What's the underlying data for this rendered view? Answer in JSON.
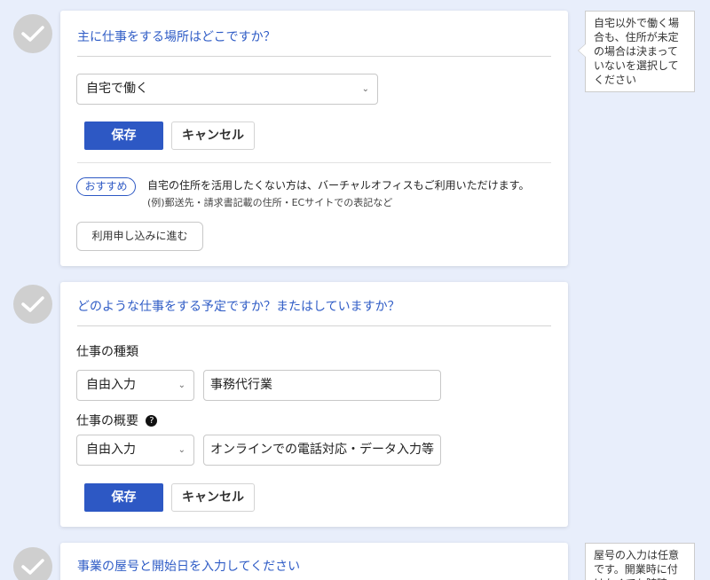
{
  "section1": {
    "title": "主に仕事をする場所はどこですか？",
    "select_value": "自宅で働く",
    "save_label": "保存",
    "cancel_label": "キャンセル",
    "badge": "おすすめ",
    "recommend_text": "自宅の住所を活用したくない方は、バーチャルオフィスもご利用いただけます。",
    "recommend_sub": "(例)郵送先・請求書記載の住所・ECサイトでの表記など",
    "apply_label": "利用申し込みに進む",
    "tooltip": "自宅以外で働く場合も、住所が未定の場合は決まっていないを選択してください"
  },
  "section2": {
    "title": "どのような仕事をする予定ですか？またはしていますか？",
    "type_label": "仕事の種類",
    "type_select": "自由入力",
    "type_value": "事務代行業",
    "summary_label": "仕事の概要",
    "summary_select": "自由入力",
    "summary_value": "オンラインでの電話対応・データ入力等",
    "save_label": "保存",
    "cancel_label": "キャンセル"
  },
  "section3": {
    "title": "事業の屋号と開始日を入力してください",
    "tooltip": "屋号の入力は任意です。開業時に付けなくても随時"
  }
}
